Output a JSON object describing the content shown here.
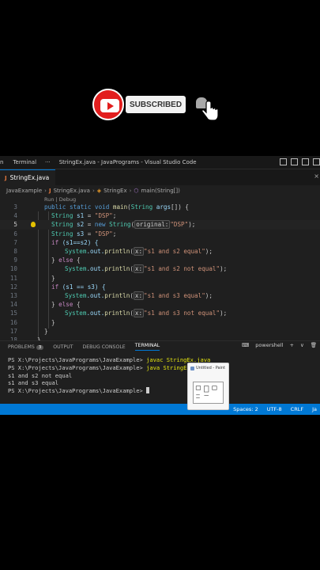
{
  "overlay": {
    "subscribe_label": "SUBSCRIBED"
  },
  "titlebar": {
    "menu_left": "n",
    "menu_terminal": "Terminal",
    "menu_more": "···",
    "window_title": "StringEx.java - JavaPrograms - Visual Studio Code"
  },
  "tab": {
    "icon_text": "J",
    "label": "StringEx.java"
  },
  "breadcrumb": {
    "folder": "JavaExample",
    "file": "StringEx.java",
    "class": "StringEx",
    "method": "main(String[])"
  },
  "codelens": "Run | Debug",
  "code_lines": [
    {
      "n": "3"
    },
    {
      "n": "4"
    },
    {
      "n": "5"
    },
    {
      "n": "6"
    },
    {
      "n": "7"
    },
    {
      "n": "8"
    },
    {
      "n": "9"
    },
    {
      "n": "10"
    },
    {
      "n": "11"
    },
    {
      "n": "12"
    },
    {
      "n": "13"
    },
    {
      "n": "14"
    },
    {
      "n": "15"
    },
    {
      "n": "16"
    },
    {
      "n": "17"
    },
    {
      "n": "18"
    }
  ],
  "code": {
    "l3_kw": "public static void ",
    "l3_fn": "main",
    "l3_p": "(",
    "l3_ty": "String",
    "l3_a": " args",
    "l3_end": "[]) {",
    "l4_ty": "String",
    "l4_v": " s1",
    "l4_eq": " = ",
    "l4_s": "\"DSP\"",
    "l4_end": ";",
    "l5_ty": "String",
    "l5_v": " s2",
    "l5_eq": " = ",
    "l5_new": "new ",
    "l5_ty2": "String",
    "l5_p": "(",
    "l5_hint": "original:",
    "l5_s": "\"DSP\"",
    "l5_end": ");",
    "l6_ty": "String",
    "l6_v": " s3",
    "l6_eq": " = ",
    "l6_s": "\"DSP\"",
    "l6_end": ";",
    "l7_if": "if",
    "l7_rest": " (s1==s2) {",
    "l8_sys": "System",
    "l8_out": ".out.",
    "l8_fn": "println",
    "l8_p": "(",
    "l8_hint": "x:",
    "l8_s": "\"s1 and s2 equal\"",
    "l8_end": ");",
    "l9_else": "} ",
    "l9_kw": "else",
    "l9_end": " {",
    "l10_sys": "System",
    "l10_out": ".out.",
    "l10_fn": "println",
    "l10_p": "(",
    "l10_hint": "x:",
    "l10_s": "\"s1 and s2 not equal\"",
    "l10_end": ");",
    "l11": "}",
    "l12_if": "if",
    "l12_rest": " (s1 == s3) {",
    "l13_sys": "System",
    "l13_out": ".out.",
    "l13_fn": "println",
    "l13_p": "(",
    "l13_hint": "x:",
    "l13_s": "\"s1 and s3 equal\"",
    "l13_end": ");",
    "l14_else": "} ",
    "l14_kw": "else",
    "l14_end": " {",
    "l15_sys": "System",
    "l15_out": ".out.",
    "l15_fn": "println",
    "l15_p": "(",
    "l15_hint": "x:",
    "l15_s": "\"s1 and s3 not equal\"",
    "l15_end": ");",
    "l16": "}",
    "l17": "}",
    "l18": "}"
  },
  "panel": {
    "tabs": [
      "PROBLEMS",
      "OUTPUT",
      "DEBUG CONSOLE",
      "TERMINAL"
    ],
    "problems_count": "3",
    "shell": "powershell",
    "add": "+",
    "chevron": "∨"
  },
  "terminal": {
    "prompt1": "PS X:\\Projects\\JavaPrograms\\JavaExample> ",
    "cmd1": "javac StringEx.java",
    "prompt2": "PS X:\\Projects\\JavaPrograms\\JavaExample> ",
    "cmd2": "java StringEx",
    "out1": "s1 and s2 not equal",
    "out2": "s1 and s3 equal",
    "prompt3": "PS X:\\Projects\\JavaPrograms\\JavaExample> "
  },
  "statusbar": {
    "spaces": "Spaces: 2",
    "encoding": "UTF-8",
    "eol": "CRLF",
    "lang": "Ja"
  },
  "popup": {
    "title": "Untitled - Paint"
  }
}
